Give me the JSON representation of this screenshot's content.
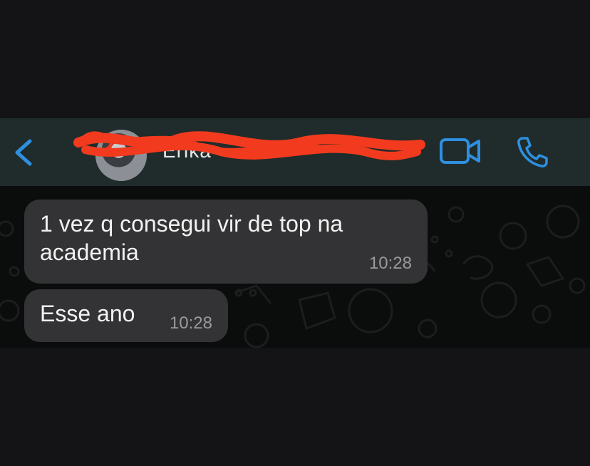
{
  "colors": {
    "accent": "#2f8fe0",
    "header_bg": "#1f2c2b",
    "bubble_bg": "#333335",
    "redaction": "#f23a1e"
  },
  "header": {
    "contact_name": "Erika",
    "icons": {
      "back": "chevron-left-icon",
      "video": "video-camera-icon",
      "call": "phone-icon"
    }
  },
  "messages": [
    {
      "text": "1 vez q consegui vir de top na academia",
      "time": "10:28"
    },
    {
      "text": "Esse ano",
      "time": "10:28"
    }
  ]
}
